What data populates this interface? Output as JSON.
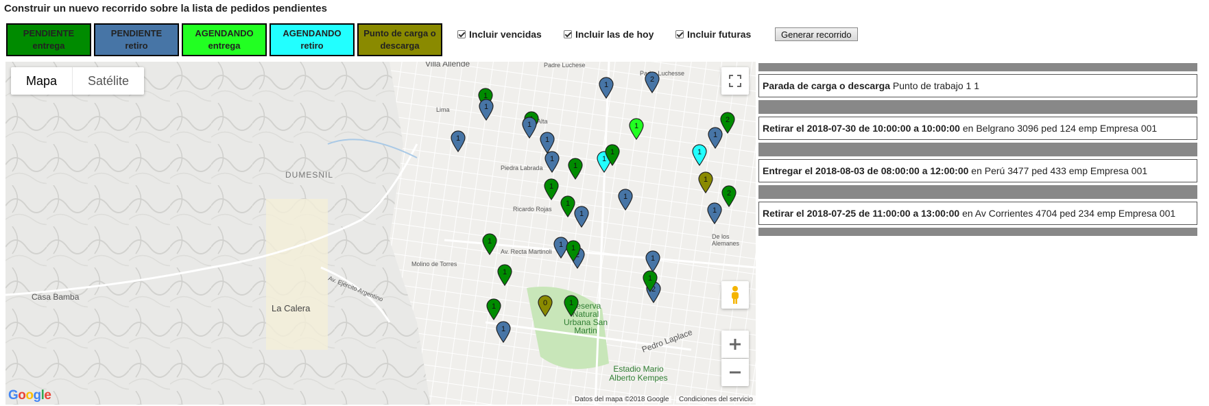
{
  "header": {
    "title": "Construir un nuevo recorrido sobre la lista de pedidos pendientes"
  },
  "legend": [
    {
      "line1": "PENDIENTE",
      "line2": "entrega",
      "color": "#008b00"
    },
    {
      "line1": "PENDIENTE",
      "line2": "retiro",
      "color": "#4775a6"
    },
    {
      "line1": "AGENDANDO",
      "line2": "entrega",
      "color": "#22ff22"
    },
    {
      "line1": "AGENDANDO",
      "line2": "retiro",
      "color": "#22ffff"
    },
    {
      "line1": "Punto de carga o",
      "line2": "descarga",
      "color": "#8a8a00"
    }
  ],
  "options": {
    "vencidas": "Incluir vencidas",
    "hoy": "Incluir las de hoy",
    "futuras": "Incluir futuras"
  },
  "generate_button": "Generar recorrido",
  "map": {
    "type_map": "Mapa",
    "type_satellite": "Satélite",
    "labels": {
      "villa_allende": "Villa Allende",
      "padre_luchese": "Padre Luchese",
      "padre_luchesse": "Padre Luchesse",
      "dumesnil": "DUMESNIL",
      "casa_bamba": "Casa Bamba",
      "la_calera": "La Calera",
      "reserva": "Reserva Natural Urbana San Martin",
      "estadio": "Estadio Mario Alberto Kempes",
      "pedro_laplace": "Pedro Laplace",
      "piedra_labrada": "Piedra Labrada",
      "ricardo_rojas": "Ricardo Rojas",
      "av_recta_martinoli": "Av. Recta Martinoli",
      "av_ejercito_argentino": "Av. Ejército Argentino",
      "cruz_alta": "Cruz Alta",
      "lima": "Lima",
      "de_los_alemanes": "De los Alemanes",
      "molino_de_torres": "Molino de Torres"
    },
    "data_credit": "Datos del mapa ©2018 Google",
    "terms": "Condiciones del servicio",
    "google": "Google",
    "pins": [
      {
        "label": "1",
        "color": "#4775a6"
      },
      {
        "label": "2",
        "color": "#4775a6"
      },
      {
        "label": "1",
        "color": "#008b00"
      },
      {
        "label": "1",
        "color": "#4775a6"
      },
      {
        "label": "1",
        "color": "#4775a6"
      },
      {
        "label": "1",
        "color": "#008b00"
      },
      {
        "label": "1",
        "color": "#4775a6"
      },
      {
        "label": "1",
        "color": "#4775a6"
      },
      {
        "label": "1",
        "color": "#008b00"
      },
      {
        "label": "1",
        "color": "#22ff22"
      },
      {
        "label": "1",
        "color": "#22ffff"
      },
      {
        "label": "1",
        "color": "#008b00"
      },
      {
        "label": "1",
        "color": "#008b00"
      },
      {
        "label": "1",
        "color": "#4775a6"
      },
      {
        "label": "1",
        "color": "#22ffff"
      },
      {
        "label": "1",
        "color": "#8a8a00"
      },
      {
        "label": "2",
        "color": "#008b00"
      },
      {
        "label": "1",
        "color": "#4775a6"
      },
      {
        "label": "2",
        "color": "#008b00"
      },
      {
        "label": "1",
        "color": "#4775a6"
      },
      {
        "label": "1",
        "color": "#4775a6"
      },
      {
        "label": "1",
        "color": "#008b00"
      },
      {
        "label": "1",
        "color": "#4775a6"
      },
      {
        "label": "1",
        "color": "#008b00"
      },
      {
        "label": "2",
        "color": "#4775a6"
      },
      {
        "label": "1",
        "color": "#4775a6"
      },
      {
        "label": "1",
        "color": "#008b00"
      },
      {
        "label": "1",
        "color": "#4775a6"
      },
      {
        "label": "1",
        "color": "#008b00"
      },
      {
        "label": "0",
        "color": "#8a8a00"
      },
      {
        "label": "1",
        "color": "#008b00"
      },
      {
        "label": "1",
        "color": "#008b00"
      },
      {
        "label": "1",
        "color": "#4775a6"
      },
      {
        "label": "2",
        "color": "#4775a6"
      },
      {
        "label": "1",
        "color": "#008b00"
      }
    ]
  },
  "stops": [
    {
      "bold": "Parada de carga o descarga",
      "rest": " Punto de trabajo 1 1"
    },
    {
      "bold": "Retirar el 2018-07-30 de 10:00:00 a 10:00:00",
      "rest": " en Belgrano 3096 ped 124 emp Empresa 001"
    },
    {
      "bold": "Entregar el 2018-08-03 de 08:00:00 a 12:00:00",
      "rest": " en Perú 3477 ped 433 emp Empresa 001"
    },
    {
      "bold": "Retirar el 2018-07-25 de 11:00:00 a 13:00:00",
      "rest": " en Av Corrientes 4704 ped 234 emp Empresa 001"
    }
  ]
}
